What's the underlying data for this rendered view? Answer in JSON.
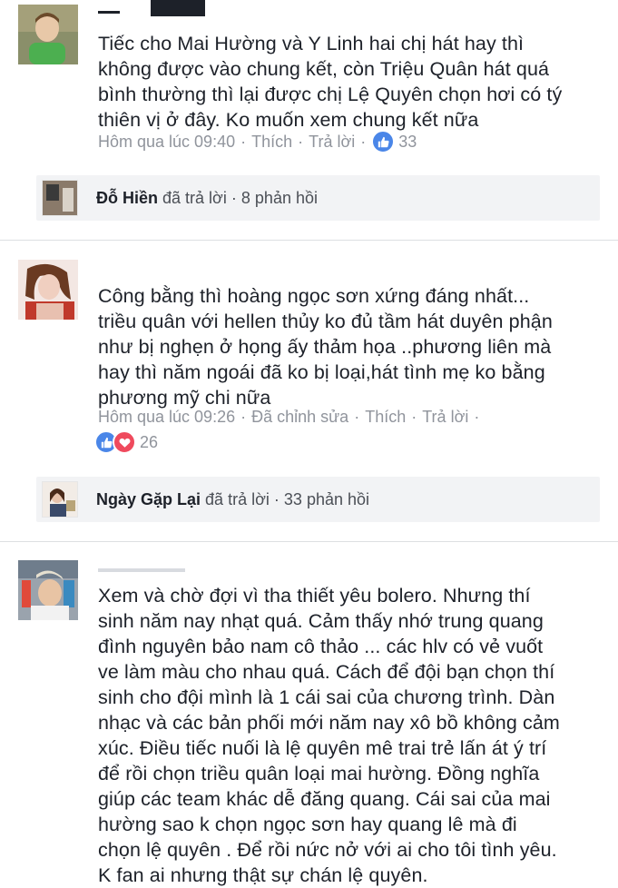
{
  "comments": [
    {
      "text": "Tiếc cho Mai Hường và Y Linh hai chị hát hay thì\nkhông được vào chung kết, còn Triệu Quân hát quá\nbình thường thì lại được chị Lệ Quyên chọn hơi có tý\nthiên vị ở đây. Ko muốn xem chung kết nữa",
      "time": "Hôm qua lúc 09:40",
      "like": "Thích",
      "reply": "Trả lời",
      "reaction_count": "33",
      "reply_summary": {
        "name": "Đỗ Hiền",
        "action": "đã trả lời",
        "sep": "·",
        "count": "8 phản hồi"
      }
    },
    {
      "text": "Công bằng thì hoàng ngọc sơn xứng đáng nhất...\ntriều quân với hellen thủy ko đủ tầm hát duyên phận\nnhư bị nghẹn ở họng ấy thảm họa ..phương liên mà\nhay thì năm ngoái đã ko bị loại,hát tình mẹ ko bằng\nphương mỹ chi nữa",
      "time": "Hôm qua lúc 09:26",
      "edited": "Đã chỉnh sửa",
      "like": "Thích",
      "reply": "Trả lời",
      "reaction_count": "26",
      "reply_summary": {
        "name": "Ngày Gặp Lại",
        "action": "đã trả lời",
        "sep": "·",
        "count": "33 phản hồi"
      }
    },
    {
      "text": "Xem và chờ đợi vì tha thiết yêu bolero. Nhưng thí\nsinh năm nay nhạt quá. Cảm thấy nhớ trung quang\nđình nguyên bảo nam cô thảo ... các hlv có vẻ vuốt\nve làm màu cho nhau quá. Cách để đội bạn chọn thí\nsinh cho đội mình là 1 cái sai của chương trình. Dàn\nnhạc và các bản phối mới năm nay xô bồ không cảm\nxúc. Điều tiếc nuối là lệ quyên mê trai trẻ lấn át ý trí\nđể rồi chọn triều quân loại mai hường. Đồng nghĩa\ngiúp các team khác dễ đăng quang. Cái sai của mai\nhường sao k chọn ngọc sơn hay quang lê mà đi\nchọn lệ quyên . Để rồi nức nở với ai cho tôi tình yêu.\nK fan ai nhưng thật sự chán lệ quyên."
    }
  ],
  "colors": {
    "meta": "#90949c",
    "like_blue": "#4a86e8",
    "love_red": "#ef4a5d",
    "reply_bg": "#f2f3f5"
  },
  "icons": [
    "like-reaction-icon",
    "love-reaction-icon"
  ]
}
